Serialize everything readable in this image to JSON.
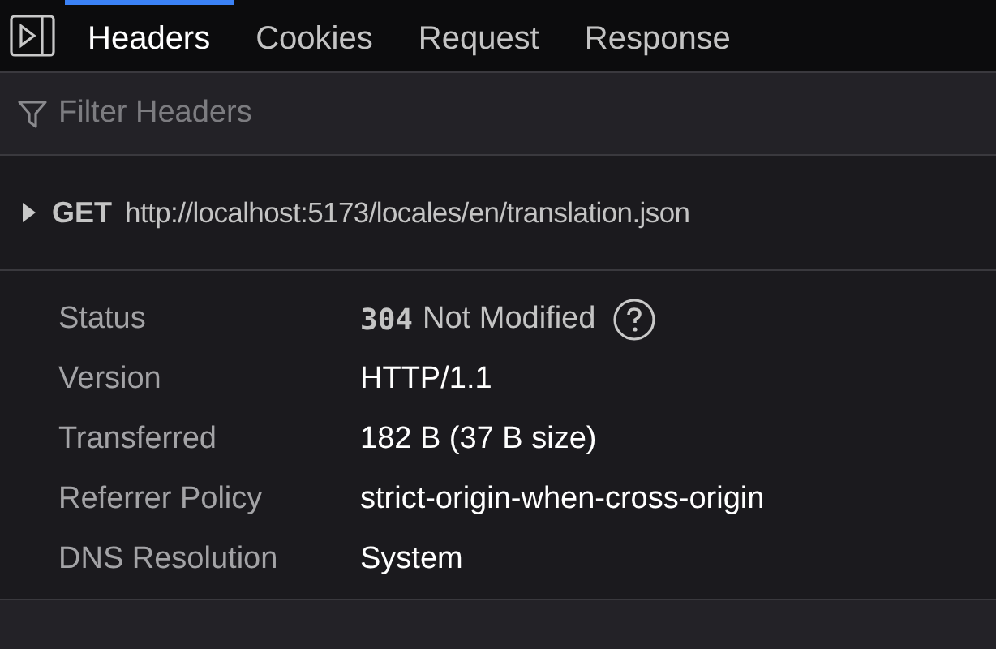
{
  "tabs": [
    {
      "label": "Headers",
      "selected": true
    },
    {
      "label": "Cookies",
      "selected": false
    },
    {
      "label": "Request",
      "selected": false
    },
    {
      "label": "Response",
      "selected": false
    }
  ],
  "filter": {
    "placeholder": "Filter Headers"
  },
  "request": {
    "expanded": false,
    "method": "GET",
    "url": "http://localhost:5173/locales/en/translation.json"
  },
  "details": [
    {
      "kind": "status",
      "label": "Status",
      "code": "304",
      "value": "Not Modified"
    },
    {
      "kind": "text",
      "label": "Version",
      "value": "HTTP/1.1"
    },
    {
      "kind": "text",
      "label": "Transferred",
      "value": "182 B (37 B size)"
    },
    {
      "kind": "text",
      "label": "Referrer Policy",
      "value": "strict-origin-when-cross-origin"
    },
    {
      "kind": "text",
      "label": "DNS Resolution",
      "value": "System"
    }
  ]
}
